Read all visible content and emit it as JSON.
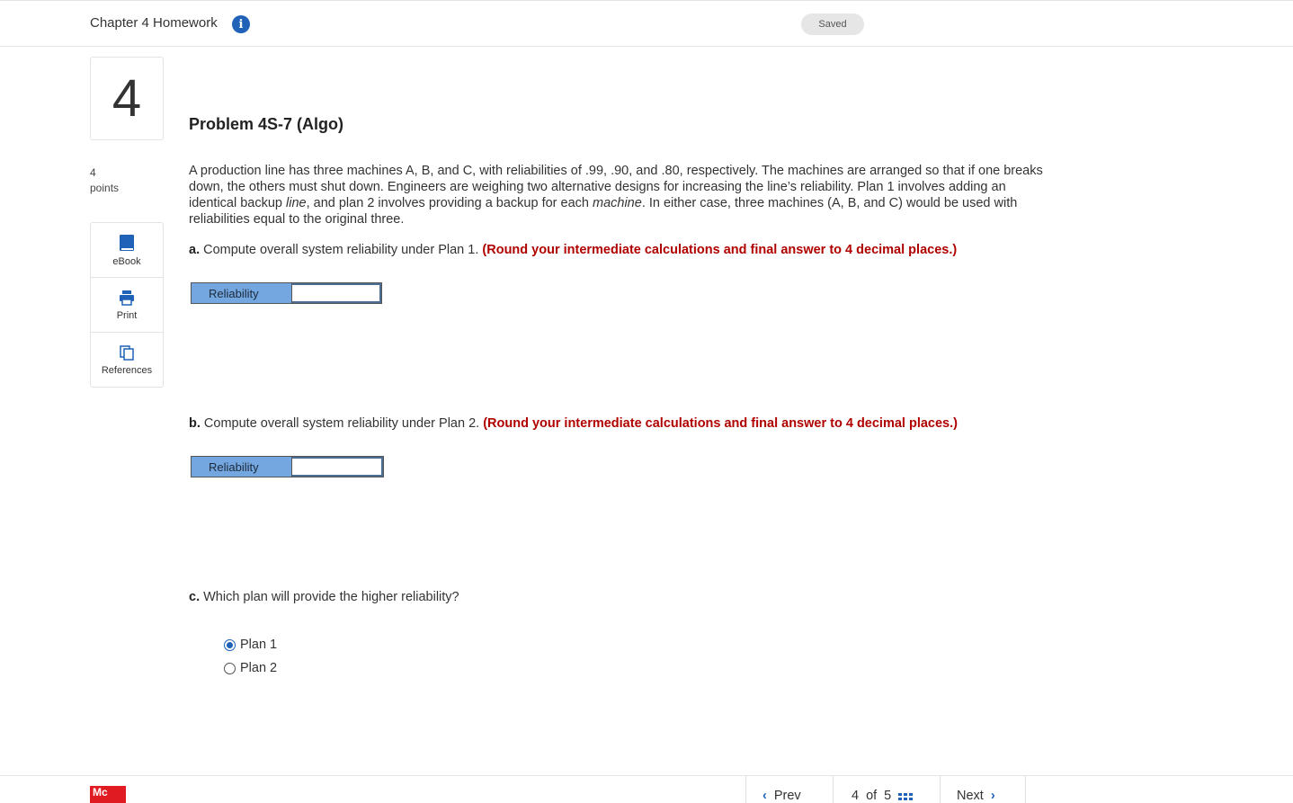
{
  "header": {
    "title": "Chapter 4 Homework",
    "info_glyph": "i",
    "status": "Saved"
  },
  "question": {
    "number": "4",
    "points_value": "4",
    "points_label": "points"
  },
  "tools": [
    {
      "label": "eBook",
      "icon": "book-icon"
    },
    {
      "label": "Print",
      "icon": "printer-icon"
    },
    {
      "label": "References",
      "icon": "references-icon"
    }
  ],
  "problem": {
    "title": "Problem 4S-7 (Algo)",
    "stem_1": "A production line has three machines A, B, and C, with reliabilities of .99, .90, and .80, respectively. The machines are arranged so that if one breaks down, the others must shut down. Engineers are weighing two alternative designs for increasing the line’s reliability. Plan 1 involves adding an identical backup ",
    "stem_em_1": "line",
    "stem_2": ", and plan 2 involves providing a backup for each ",
    "stem_em_2": "machine",
    "stem_3": ". In either case, three machines (A, B, and C) would be used with reliabilities equal to the original three."
  },
  "part_a": {
    "letter": "a.",
    "text": " Compute overall system reliability under Plan 1. ",
    "note": "(Round your intermediate calculations and final answer to 4 decimal places.)",
    "answer_label": "Reliability",
    "answer_value": ""
  },
  "part_b": {
    "letter": "b.",
    "text": " Compute overall system reliability under Plan 2. ",
    "note": "(Round your intermediate calculations and final answer to 4 decimal places.)",
    "answer_label": "Reliability",
    "answer_value": ""
  },
  "part_c": {
    "letter": "c.",
    "text": " Which plan will provide the higher reliability?",
    "options": [
      {
        "label": "Plan 1",
        "selected": true
      },
      {
        "label": "Plan 2",
        "selected": false
      }
    ]
  },
  "footer": {
    "logo_text": "Mc",
    "prev_label": "Prev",
    "prev_chevron": "‹",
    "page_current": "4",
    "page_of": "of",
    "page_total": "5",
    "next_label": "Next",
    "next_chevron": "›"
  },
  "colors": {
    "accent": "#1f62b8",
    "note_red": "#b00000",
    "answer_label_bg": "#74a7e0",
    "logo_red": "#e11b22"
  }
}
